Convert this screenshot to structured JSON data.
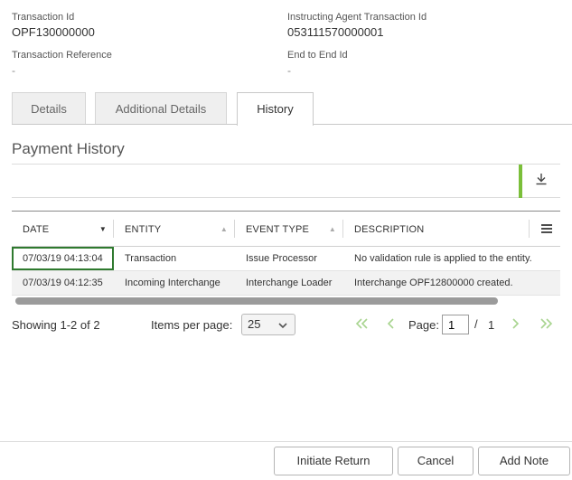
{
  "transaction": {
    "transaction_id": {
      "label": "Transaction Id",
      "value": "OPF130000000"
    },
    "instructing_agent_transaction_id": {
      "label": "Instructing Agent Transaction Id",
      "value": "053111570000001"
    },
    "transaction_reference": {
      "label": "Transaction Reference",
      "value": "-"
    },
    "end_to_end_id": {
      "label": "End to End Id",
      "value": "-"
    }
  },
  "tabs": [
    {
      "label": "Details",
      "active": false
    },
    {
      "label": "Additional Details",
      "active": false
    },
    {
      "label": "History",
      "active": true
    }
  ],
  "section": {
    "title": "Payment History"
  },
  "toolbar": {
    "download_icon": "download-icon",
    "accent_color": "#7bbf3a"
  },
  "grid": {
    "columns": [
      "DATE",
      "ENTITY",
      "EVENT TYPE",
      "DESCRIPTION"
    ],
    "sorted_column": "DATE",
    "menu_icon": "hamburger-menu-icon",
    "rows": [
      {
        "date": "07/03/19 04:13:04",
        "entity": "Transaction",
        "event_type": "Issue Processor",
        "description": "No validation rule is applied to the entity."
      },
      {
        "date": "07/03/19 04:12:35",
        "entity": "Incoming Interchange",
        "event_type": "Interchange Loader",
        "description": "Interchange OPF12800000 created."
      }
    ]
  },
  "pagination": {
    "summary": "Showing 1-2 of 2",
    "items_per_page_label": "Items per page:",
    "items_per_page_value": "25",
    "page_label": "Page:",
    "page_value": "1",
    "separator": "/",
    "total_pages": "1"
  },
  "actions": {
    "initiate_return": "Initiate Return",
    "cancel": "Cancel",
    "add_note": "Add Note"
  },
  "colors": {
    "focus_border": "#2f7a2f",
    "nav_enabled": "#8cc56b"
  }
}
